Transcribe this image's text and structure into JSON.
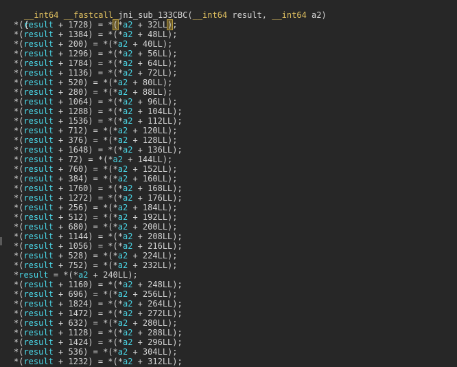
{
  "signature": {
    "ret_type": "__int64",
    "call_conv": "__fastcall",
    "func_name": "jni_sub_133CBC",
    "open_paren": "(",
    "param1_type": "__int64",
    "param1_name": "result",
    "sep": ", ",
    "param2_type": "__int64",
    "param2_name": "a2",
    "close_paren": ")"
  },
  "open_brace": "{",
  "lines": [
    {
      "off": "1728",
      "src": "32"
    },
    {
      "off": "1384",
      "src": "48"
    },
    {
      "off": "200",
      "src": "40"
    },
    {
      "off": "1296",
      "src": "56"
    },
    {
      "off": "1784",
      "src": "64"
    },
    {
      "off": "1136",
      "src": "72"
    },
    {
      "off": "520",
      "src": "80"
    },
    {
      "off": "280",
      "src": "88"
    },
    {
      "off": "1064",
      "src": "96"
    },
    {
      "off": "1288",
      "src": "104"
    },
    {
      "off": "1536",
      "src": "112"
    },
    {
      "off": "712",
      "src": "120"
    },
    {
      "off": "376",
      "src": "128"
    },
    {
      "off": "1648",
      "src": "136"
    },
    {
      "off": "72",
      "src": "144"
    },
    {
      "off": "760",
      "src": "152"
    },
    {
      "off": "384",
      "src": "160"
    },
    {
      "off": "1760",
      "src": "168"
    },
    {
      "off": "1272",
      "src": "176"
    },
    {
      "off": "256",
      "src": "184"
    },
    {
      "off": "512",
      "src": "192"
    },
    {
      "off": "680",
      "src": "200"
    },
    {
      "off": "1144",
      "src": "208"
    },
    {
      "off": "1056",
      "src": "216"
    },
    {
      "off": "528",
      "src": "224"
    },
    {
      "off": "752",
      "src": "232"
    },
    {
      "off": null,
      "src": "240"
    },
    {
      "off": "1160",
      "src": "248"
    },
    {
      "off": "696",
      "src": "256"
    },
    {
      "off": "1824",
      "src": "264"
    },
    {
      "off": "1472",
      "src": "272"
    },
    {
      "off": "632",
      "src": "280"
    },
    {
      "off": "1128",
      "src": "288"
    },
    {
      "off": "1424",
      "src": "296"
    },
    {
      "off": "536",
      "src": "304"
    },
    {
      "off": "1232",
      "src": "312"
    }
  ],
  "colors": {
    "background": "#272727",
    "keyword": "#e0c060",
    "variable": "#4ad6e6",
    "text": "#d4d4d4",
    "highlight": "#6a5a2a"
  }
}
